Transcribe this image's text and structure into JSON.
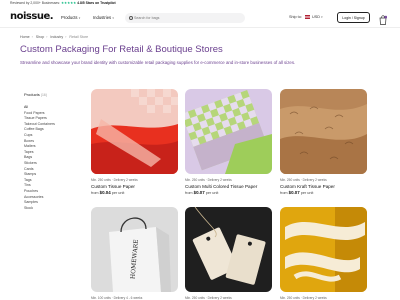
{
  "topbar": {
    "prefix": "Reviewed by 2,000+ Businesses:",
    "stars": "★★★★★",
    "rating": "4.8/5 Stars on Trustpilot"
  },
  "header": {
    "logo": "noissue.",
    "nav": [
      {
        "label": "Products"
      },
      {
        "label": "Industries"
      }
    ],
    "search_placeholder": "Search for bags",
    "ship_to_label": "Ship to:",
    "currency": "USD",
    "login_label": "Login / Signup"
  },
  "breadcrumb": [
    "Home",
    "Shop",
    "Industry",
    "Retail Store"
  ],
  "page": {
    "title": "Custom Packaging For Retail & Boutique Stores",
    "description": "Streamline and showcase your brand identity with customizable retail packaging supplies for e-commerce and in-store businesses of all sizes."
  },
  "sidebar": {
    "heading": "Products",
    "count": "(16)",
    "items": [
      "All",
      "Food Papers",
      "Tissue Papers",
      "Takeout Containers",
      "Coffee Bags",
      "Cups",
      "Boxes",
      "Mailers",
      "Tapes",
      "Bags",
      "Stickers",
      "Cards",
      "Stamps",
      "Tags",
      "Tins",
      "Pouches",
      "Accessories",
      "Samples",
      "Stock"
    ]
  },
  "products": [
    {
      "meta": "Min. 250 units · Delivery 2 weeks",
      "name": "Custom Tissue Paper",
      "from": "from",
      "price": "$0.04",
      "unit": "per unit"
    },
    {
      "meta": "Min. 250 units · Delivery 2 weeks",
      "name": "Custom Multi Colored Tissue Paper",
      "from": "from",
      "price": "$0.07",
      "unit": "per unit"
    },
    {
      "meta": "Min. 250 units · Delivery 2 weeks",
      "name": "Custom Kraft Tissue Paper",
      "from": "from",
      "price": "$0.07",
      "unit": "per unit"
    },
    {
      "meta": "Min. 100 units · Delivery 4 - 6 weeks",
      "name": "",
      "from": "",
      "price": "",
      "unit": ""
    },
    {
      "meta": "Min. 250 units · Delivery 2 weeks",
      "name": "",
      "from": "",
      "price": "",
      "unit": ""
    },
    {
      "meta": "Min. 250 units · Delivery 2 weeks",
      "name": "",
      "from": "",
      "price": "",
      "unit": ""
    }
  ],
  "colors": {
    "title_purple": "#6a3f8e",
    "trustpilot_green": "#00b67a",
    "border": "#eeeeee"
  },
  "icons": [
    "search-icon",
    "cart-icon",
    "chevron-down-icon",
    "flag-us-icon"
  ]
}
